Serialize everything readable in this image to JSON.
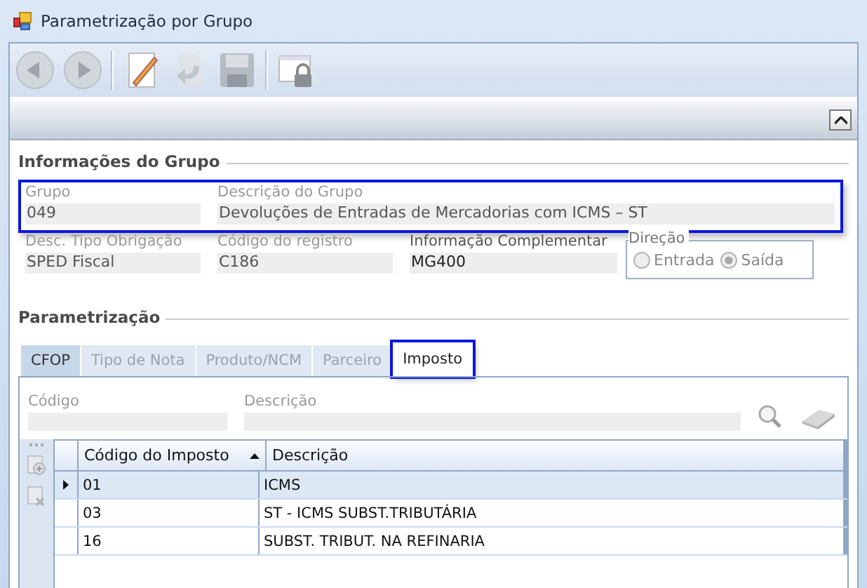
{
  "window": {
    "title": "Parametrização por Grupo"
  },
  "toolbar": [
    {
      "kind": "back",
      "disabled": true
    },
    {
      "kind": "forward",
      "disabled": true
    },
    {
      "kind": "edit",
      "disabled": false
    },
    {
      "kind": "undo",
      "disabled": true
    },
    {
      "kind": "save",
      "disabled": true
    },
    {
      "kind": "lock",
      "disabled": false
    }
  ],
  "info_section": {
    "title": "Informações do Grupo",
    "highlighted": true,
    "grupo": {
      "label": "Grupo",
      "value": "049"
    },
    "descricao": {
      "label": "Descrição do Grupo",
      "value": "Devoluções de Entradas de Mercadorias com ICMS – ST"
    },
    "tipo_obrigacao": {
      "label": "Desc. Tipo Obrigação",
      "value": "SPED Fiscal"
    },
    "codigo_registro": {
      "label": "Código do registro",
      "value": "C186"
    },
    "info_complementar": {
      "label": "Informação Complementar",
      "value": "MG400"
    },
    "direcao": {
      "label": "Direção",
      "options": [
        {
          "label": "Entrada",
          "selected": false,
          "disabled": true
        },
        {
          "label": "Saída",
          "selected": true,
          "disabled": true
        }
      ]
    }
  },
  "param_section": {
    "title": "Parametrização",
    "tabs": [
      {
        "label": "CFOP",
        "selected": false,
        "hovered": true,
        "highlighted": false
      },
      {
        "label": "Tipo de Nota",
        "selected": false,
        "hovered": false,
        "highlighted": false
      },
      {
        "label": "Produto/NCM",
        "selected": false,
        "hovered": false,
        "highlighted": false
      },
      {
        "label": "Parceiro",
        "selected": false,
        "hovered": false,
        "highlighted": false
      },
      {
        "label": "Imposto",
        "selected": true,
        "hovered": false,
        "highlighted": true
      }
    ],
    "filter": {
      "codigo": {
        "label": "Código"
      },
      "descricao": {
        "label": "Descrição"
      }
    },
    "table": {
      "columns": [
        {
          "label": "Código do Imposto",
          "sorted": true
        },
        {
          "label": "Descrição",
          "sorted": false
        }
      ],
      "rows": [
        {
          "cells": [
            "01",
            "ICMS"
          ],
          "selected": true
        },
        {
          "cells": [
            "03",
            "ST - ICMS SUBST.TRIBUTÁRIA"
          ],
          "selected": false
        },
        {
          "cells": [
            "16",
            "SUBST. TRIBUT. NA REFINARIA"
          ],
          "selected": false
        }
      ]
    }
  }
}
